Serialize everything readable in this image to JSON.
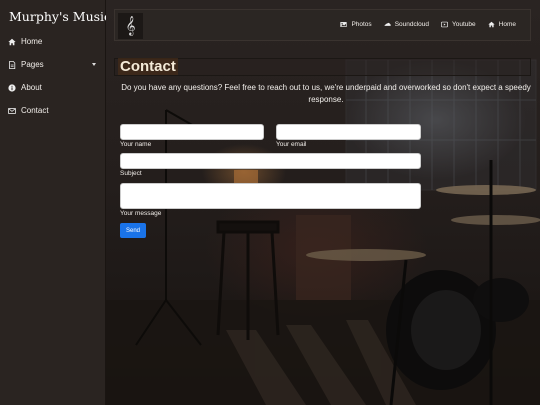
{
  "brand": "Murphy's Music",
  "sidebar": {
    "items": [
      {
        "label": "Home",
        "icon": "home-icon"
      },
      {
        "label": "Pages",
        "icon": "page-icon",
        "has_dropdown": true
      },
      {
        "label": "About",
        "icon": "info-icon"
      },
      {
        "label": "Contact",
        "icon": "envelope-icon"
      }
    ]
  },
  "topbar": {
    "logo_glyph": "𝄞",
    "links": [
      {
        "label": "Photos",
        "icon": "image-icon"
      },
      {
        "label": "Soundcloud",
        "icon": "soundcloud-icon"
      },
      {
        "label": "Youtube",
        "icon": "youtube-icon"
      },
      {
        "label": "Home",
        "icon": "home-icon"
      }
    ]
  },
  "page": {
    "title": "Contact",
    "intro": "Do you have any questions? Feel free to reach out to us, we're underpaid and overworked so don't expect a speedy response."
  },
  "form": {
    "name_label": "Your name",
    "email_label": "Your email",
    "subject_label": "Subject",
    "message_label": "Your message",
    "send_label": "Send"
  },
  "colors": {
    "sidebar_bg": "#2a2421",
    "accent_button": "#1a73e8"
  }
}
